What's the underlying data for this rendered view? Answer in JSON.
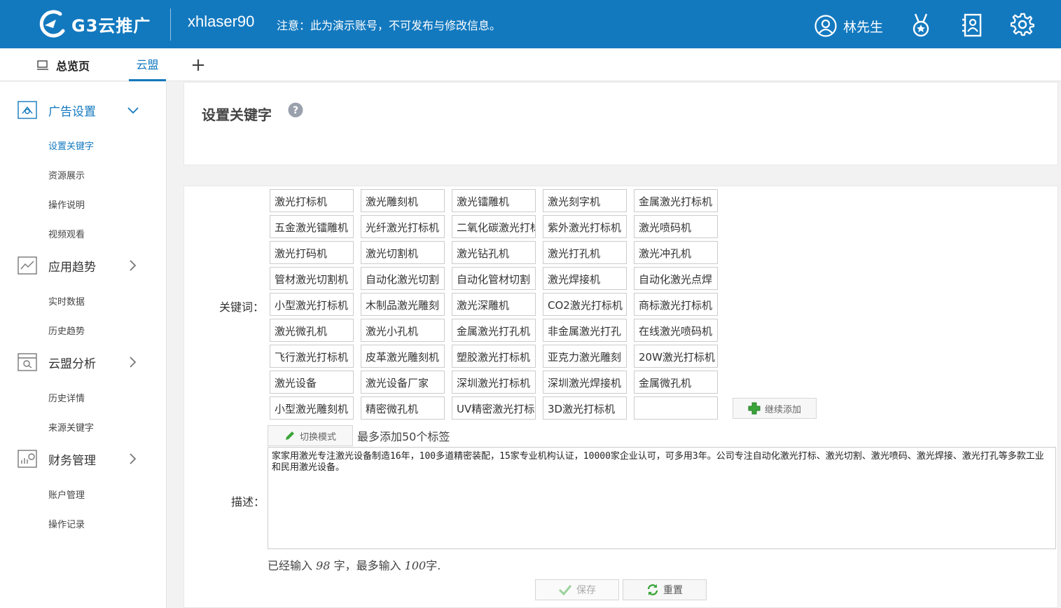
{
  "header": {
    "logo_text": "G3云推广",
    "account": "xhlaser90",
    "notice": "注意：此为演示账号，不可发布与修改信息。",
    "user_name": "林先生"
  },
  "tabs": {
    "home": "总览页",
    "yunmeng": "云盟",
    "add": "+"
  },
  "sidebar": {
    "groups": [
      {
        "label": "广告设置",
        "items": [
          "设置关键字",
          "资源展示",
          "操作说明",
          "视频观看"
        ]
      },
      {
        "label": "应用趋势",
        "items": [
          "实时数据",
          "历史趋势"
        ]
      },
      {
        "label": "云盟分析",
        "items": [
          "历史详情",
          "来源关键字"
        ]
      },
      {
        "label": "财务管理",
        "items": [
          "账户管理",
          "操作记录"
        ]
      }
    ]
  },
  "page": {
    "title": "设置关键字"
  },
  "form": {
    "keywords_label": "关键词：",
    "keywords": [
      [
        "激光打标机",
        "激光雕刻机",
        "激光镭雕机",
        "激光刻字机",
        "金属激光打标机"
      ],
      [
        "五金激光镭雕机",
        "光纤激光打标机",
        "二氧化碳激光打标机",
        "紫外激光打标机",
        "激光喷码机"
      ],
      [
        "激光打码机",
        "激光切割机",
        "激光钻孔机",
        "激光打孔机",
        "激光冲孔机"
      ],
      [
        "管材激光切割机",
        "自动化激光切割",
        "自动化管材切割",
        "激光焊接机",
        "自动化激光点焊"
      ],
      [
        "小型激光打标机",
        "木制品激光雕刻",
        "激光深雕机",
        "CO2激光打标机",
        "商标激光打标机"
      ],
      [
        "激光微孔机",
        "激光小孔机",
        "金属激光打孔机",
        "非金属激光打孔",
        "在线激光喷码机"
      ],
      [
        "飞行激光打标机",
        "皮革激光雕刻机",
        "塑胶激光打标机",
        "亚克力激光雕刻",
        "20W激光打标机"
      ],
      [
        "激光设备",
        "激光设备厂家",
        "深圳激光打标机",
        "深圳激光焊接机",
        "金属微孔机"
      ],
      [
        "小型激光雕刻机",
        "精密微孔机",
        "UV精密激光打标",
        "3D激光打标机",
        ""
      ]
    ],
    "add_button": "继续添加",
    "switch_button": "切换模式",
    "max_tip": "最多添加50个标签",
    "desc_label": "描述：",
    "description": "家家用激光专注激光设备制造16年，100多道精密装配，15家专业机构认证，10000家企业认可，可多用3年。公司专注自动化激光打标、激光切割、激光喷码、激光焊接、激光打孔等多款工业和民用激光设备。",
    "count_prefix": "已经输入",
    "count_value": "98",
    "count_mid": "字，最多输入",
    "count_max": "100",
    "count_suffix": "字.",
    "save_button": "保存",
    "reset_button": "重置"
  },
  "colors": {
    "primary": "#1379bf",
    "green": "#3aa53a"
  }
}
